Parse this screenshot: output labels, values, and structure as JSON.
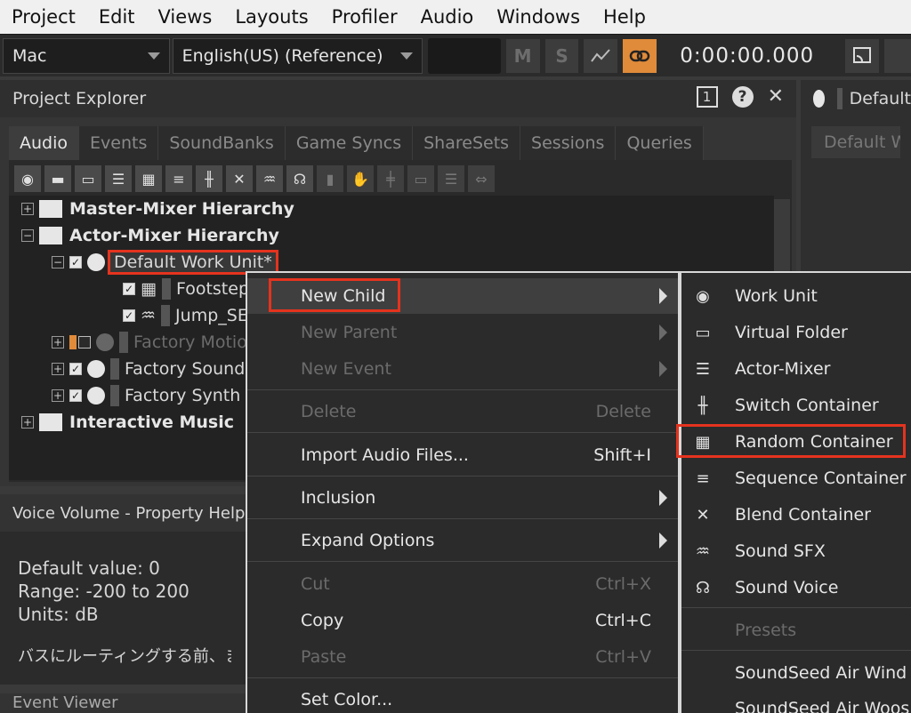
{
  "menubar": {
    "items": [
      "Project",
      "Edit",
      "Views",
      "Layouts",
      "Profiler",
      "Audio",
      "Windows",
      "Help"
    ]
  },
  "toolbar": {
    "platform": "Mac",
    "language": "English(US) (Reference)",
    "m_label": "M",
    "s_label": "S",
    "time": "0:00:00.000"
  },
  "project_explorer": {
    "title": "Project Explorer",
    "box_label": "1",
    "tabs": [
      "Audio",
      "Events",
      "SoundBanks",
      "Game Syncs",
      "ShareSets",
      "Sessions",
      "Queries"
    ],
    "tree": [
      {
        "label": "Master-Mixer Hierarchy"
      },
      {
        "label": "Actor-Mixer Hierarchy"
      },
      {
        "label": "Default Work Unit*"
      },
      {
        "label": "Footsteps"
      },
      {
        "label": "Jump_SE"
      },
      {
        "label": "Factory Motion"
      },
      {
        "label": "Factory Sound"
      },
      {
        "label": "Factory Synth"
      },
      {
        "label": "Interactive Music"
      }
    ]
  },
  "right_panel": {
    "title": "Default",
    "box_text": "Default Wo"
  },
  "property_help": {
    "title": "Voice Volume - Property Help",
    "default_value": "Default value: 0",
    "range": "Range: -200 to 200",
    "units": "Units: dB",
    "japanese": "バスにルーティングする前、まな"
  },
  "event_viewer": {
    "title": "Event Viewer"
  },
  "context_menu": {
    "new_child": "New Child",
    "new_parent": "New Parent",
    "new_event": "New Event",
    "delete": "Delete",
    "delete_shortcut": "Delete",
    "import": "Import Audio Files...",
    "import_shortcut": "Shift+I",
    "inclusion": "Inclusion",
    "expand": "Expand Options",
    "cut": "Cut",
    "cut_shortcut": "Ctrl+X",
    "copy": "Copy",
    "copy_shortcut": "Ctrl+C",
    "paste": "Paste",
    "paste_shortcut": "Ctrl+V",
    "set_color": "Set Color..."
  },
  "submenu": {
    "items": [
      {
        "label": "Work Unit",
        "icon": "work-unit-icon"
      },
      {
        "label": "Virtual Folder",
        "icon": "folder-icon"
      },
      {
        "label": "Actor-Mixer",
        "icon": "actor-mixer-icon"
      },
      {
        "label": "Switch Container",
        "icon": "switch-container-icon"
      },
      {
        "label": "Random Container",
        "icon": "random-container-icon"
      },
      {
        "label": "Sequence Container",
        "icon": "sequence-container-icon"
      },
      {
        "label": "Blend Container",
        "icon": "blend-container-icon"
      },
      {
        "label": "Sound SFX",
        "icon": "sound-sfx-icon"
      },
      {
        "label": "Sound Voice",
        "icon": "sound-voice-icon"
      },
      {
        "label": "Presets"
      },
      {
        "label": "SoundSeed Air Wind"
      },
      {
        "label": "SoundSeed Air Woosh"
      }
    ]
  },
  "colors": {
    "highlight": "#e5331e",
    "accent": "#e08b3a"
  }
}
